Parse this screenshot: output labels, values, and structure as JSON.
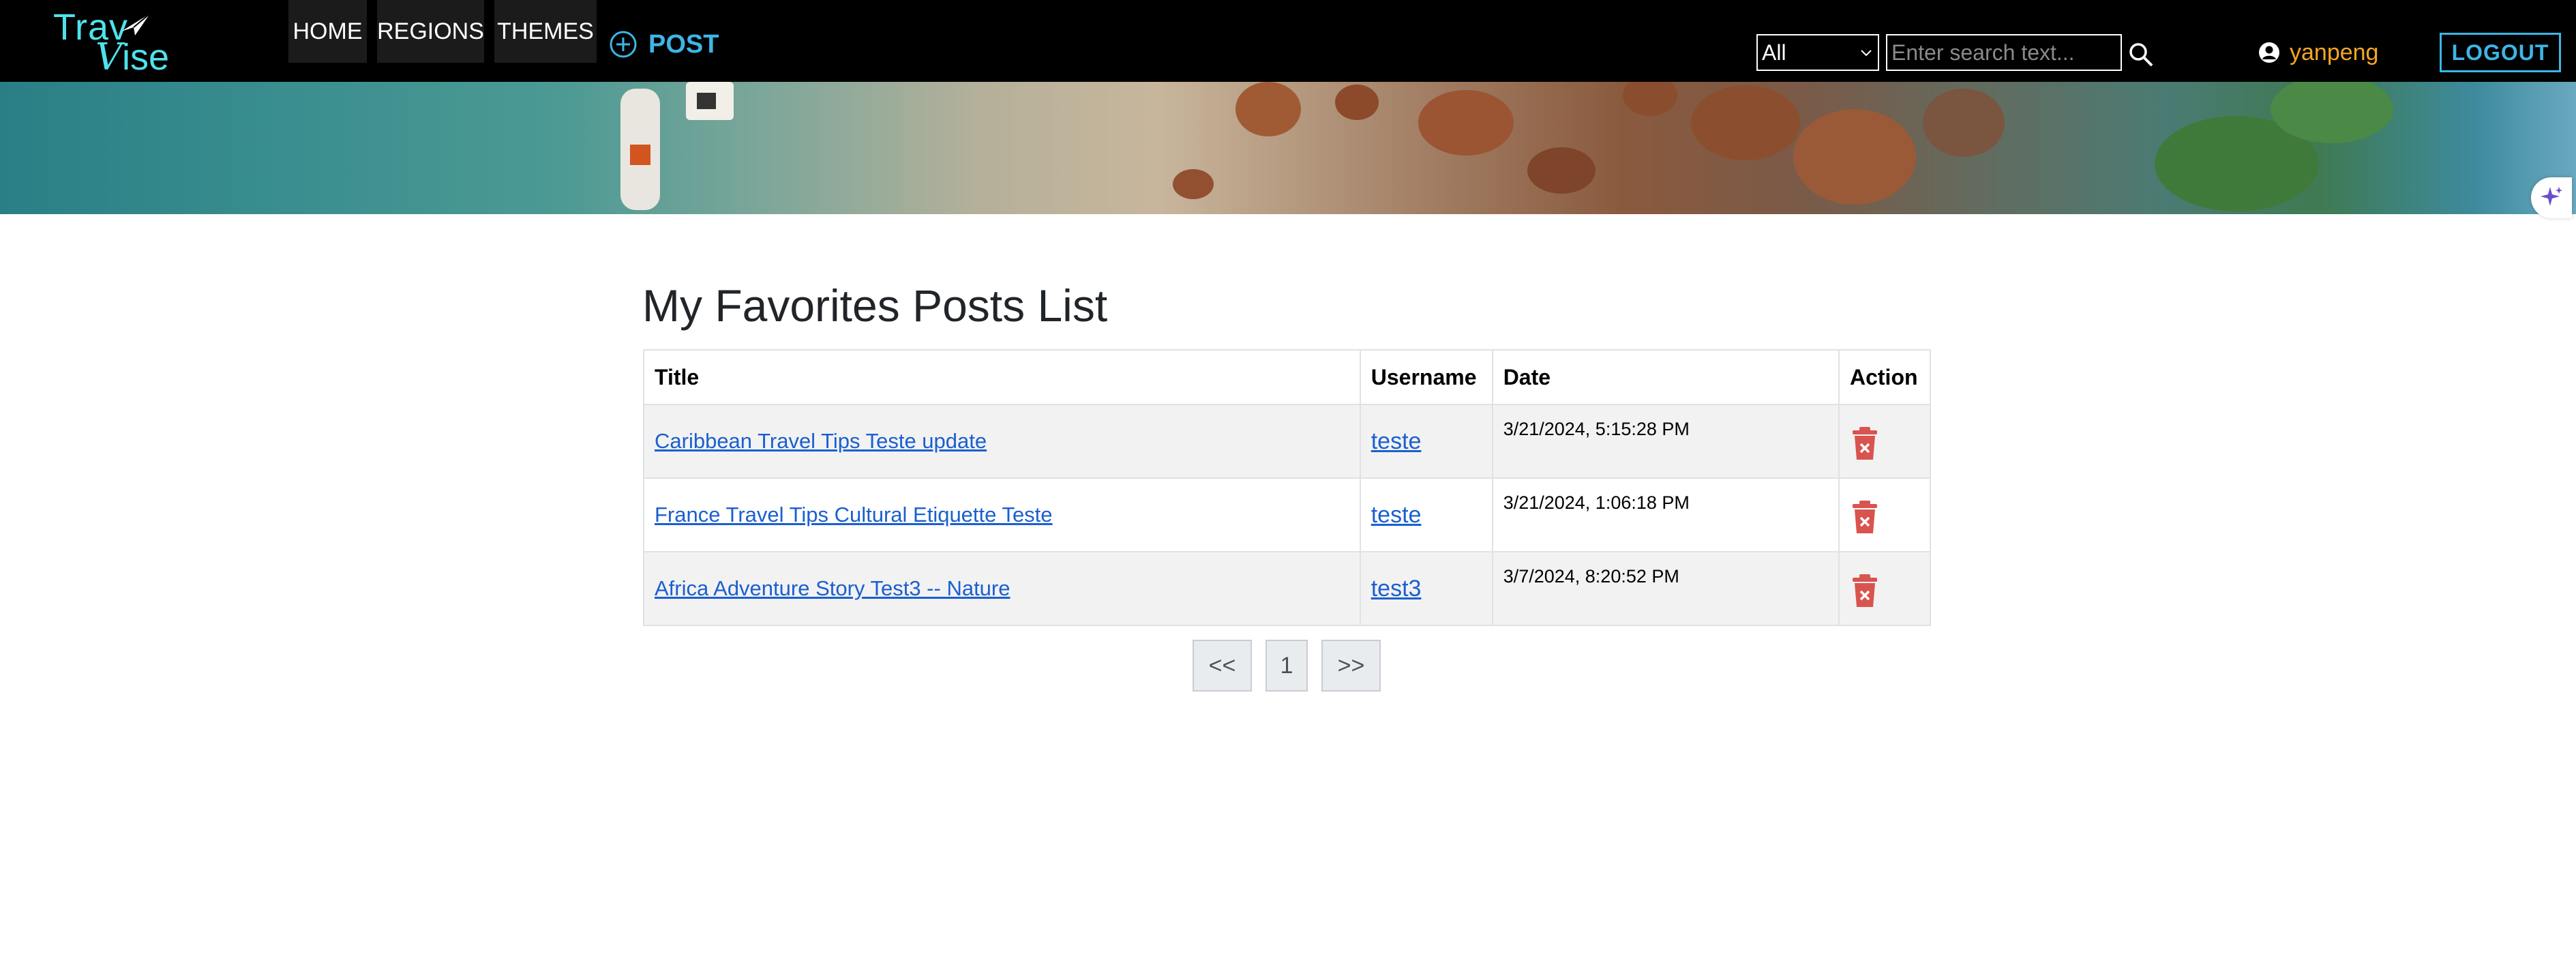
{
  "brand": {
    "logo_top": "Trav",
    "logo_bottom_v": "V",
    "logo_bottom_rest": "ise",
    "accent": "#4fe2ec"
  },
  "nav": {
    "home": "HOME",
    "regions": "REGIONS",
    "themes": "THEMES",
    "post": "POST",
    "post_icon": "plus-circle-icon"
  },
  "search": {
    "category_selected": "All",
    "placeholder": "Enter search text...",
    "icon": "search-icon"
  },
  "user": {
    "name": "yanpeng",
    "icon": "user-circle-icon",
    "color": "#f5a623"
  },
  "logout": "LOGOUT",
  "main": {
    "title": "My Favorites Posts List",
    "table": {
      "headers": {
        "title": "Title",
        "username": "Username",
        "date": "Date",
        "action": "Action"
      },
      "rows": [
        {
          "title": "Caribbean Travel Tips Teste update",
          "username": "teste",
          "date": "3/21/2024, 5:15:28 PM"
        },
        {
          "title": "France Travel Tips Cultural Etiquette Teste",
          "username": "teste",
          "date": "3/21/2024, 1:06:18 PM"
        },
        {
          "title": "Africa Adventure Story Test3 -- Nature",
          "username": "test3",
          "date": "3/7/2024, 8:20:52 PM"
        }
      ],
      "action_icon": "trash-delete-icon"
    },
    "pagination": {
      "prev": "<<",
      "current": "1",
      "next": ">>"
    }
  },
  "colors": {
    "link": "#1a5fd0",
    "delete": "#d9534f",
    "logout": "#3db5e6"
  }
}
